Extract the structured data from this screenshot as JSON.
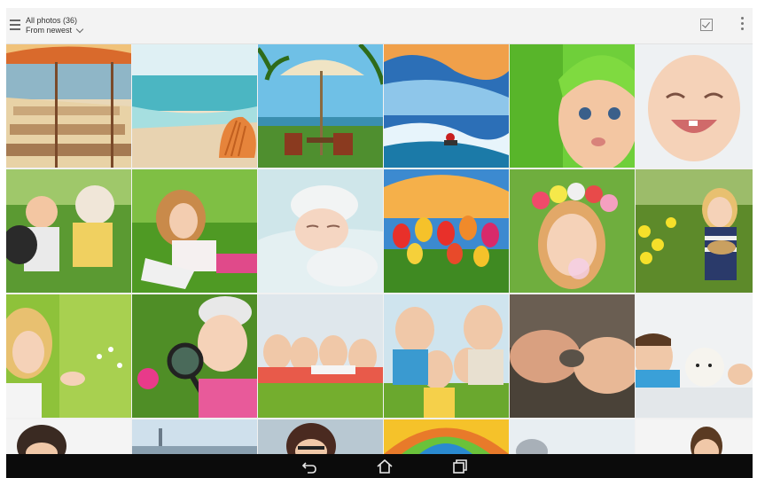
{
  "header": {
    "title": "All photos (36)",
    "sort_label": "From newest",
    "icons": {
      "menu": "hamburger-icon",
      "sort": "chevron-down-icon",
      "select": "select-check-icon",
      "more": "more-vert-icon"
    }
  },
  "photos": [
    {
      "subject": "beach-lounge-chairs"
    },
    {
      "subject": "beach-shell"
    },
    {
      "subject": "resort-umbrella"
    },
    {
      "subject": "jet-ski-wave"
    },
    {
      "subject": "baby-green-towel"
    },
    {
      "subject": "laughing-baby"
    },
    {
      "subject": "kids-with-dog"
    },
    {
      "subject": "girl-in-grass"
    },
    {
      "subject": "sleeping-baby"
    },
    {
      "subject": "tulips-sunset"
    },
    {
      "subject": "girl-flower-crown"
    },
    {
      "subject": "girl-daffodils"
    },
    {
      "subject": "girl-dandelion"
    },
    {
      "subject": "boy-magnifier"
    },
    {
      "subject": "kids-lying-grass"
    },
    {
      "subject": "group-of-kids"
    },
    {
      "subject": "hands-holding-stone"
    },
    {
      "subject": "boy-with-puppy"
    },
    {
      "subject": "partial-1"
    },
    {
      "subject": "partial-2"
    },
    {
      "subject": "partial-3"
    },
    {
      "subject": "partial-4"
    },
    {
      "subject": "partial-5"
    },
    {
      "subject": "partial-6"
    }
  ],
  "navbar": {
    "icons": [
      "back-icon",
      "home-icon",
      "recent-apps-icon"
    ]
  }
}
